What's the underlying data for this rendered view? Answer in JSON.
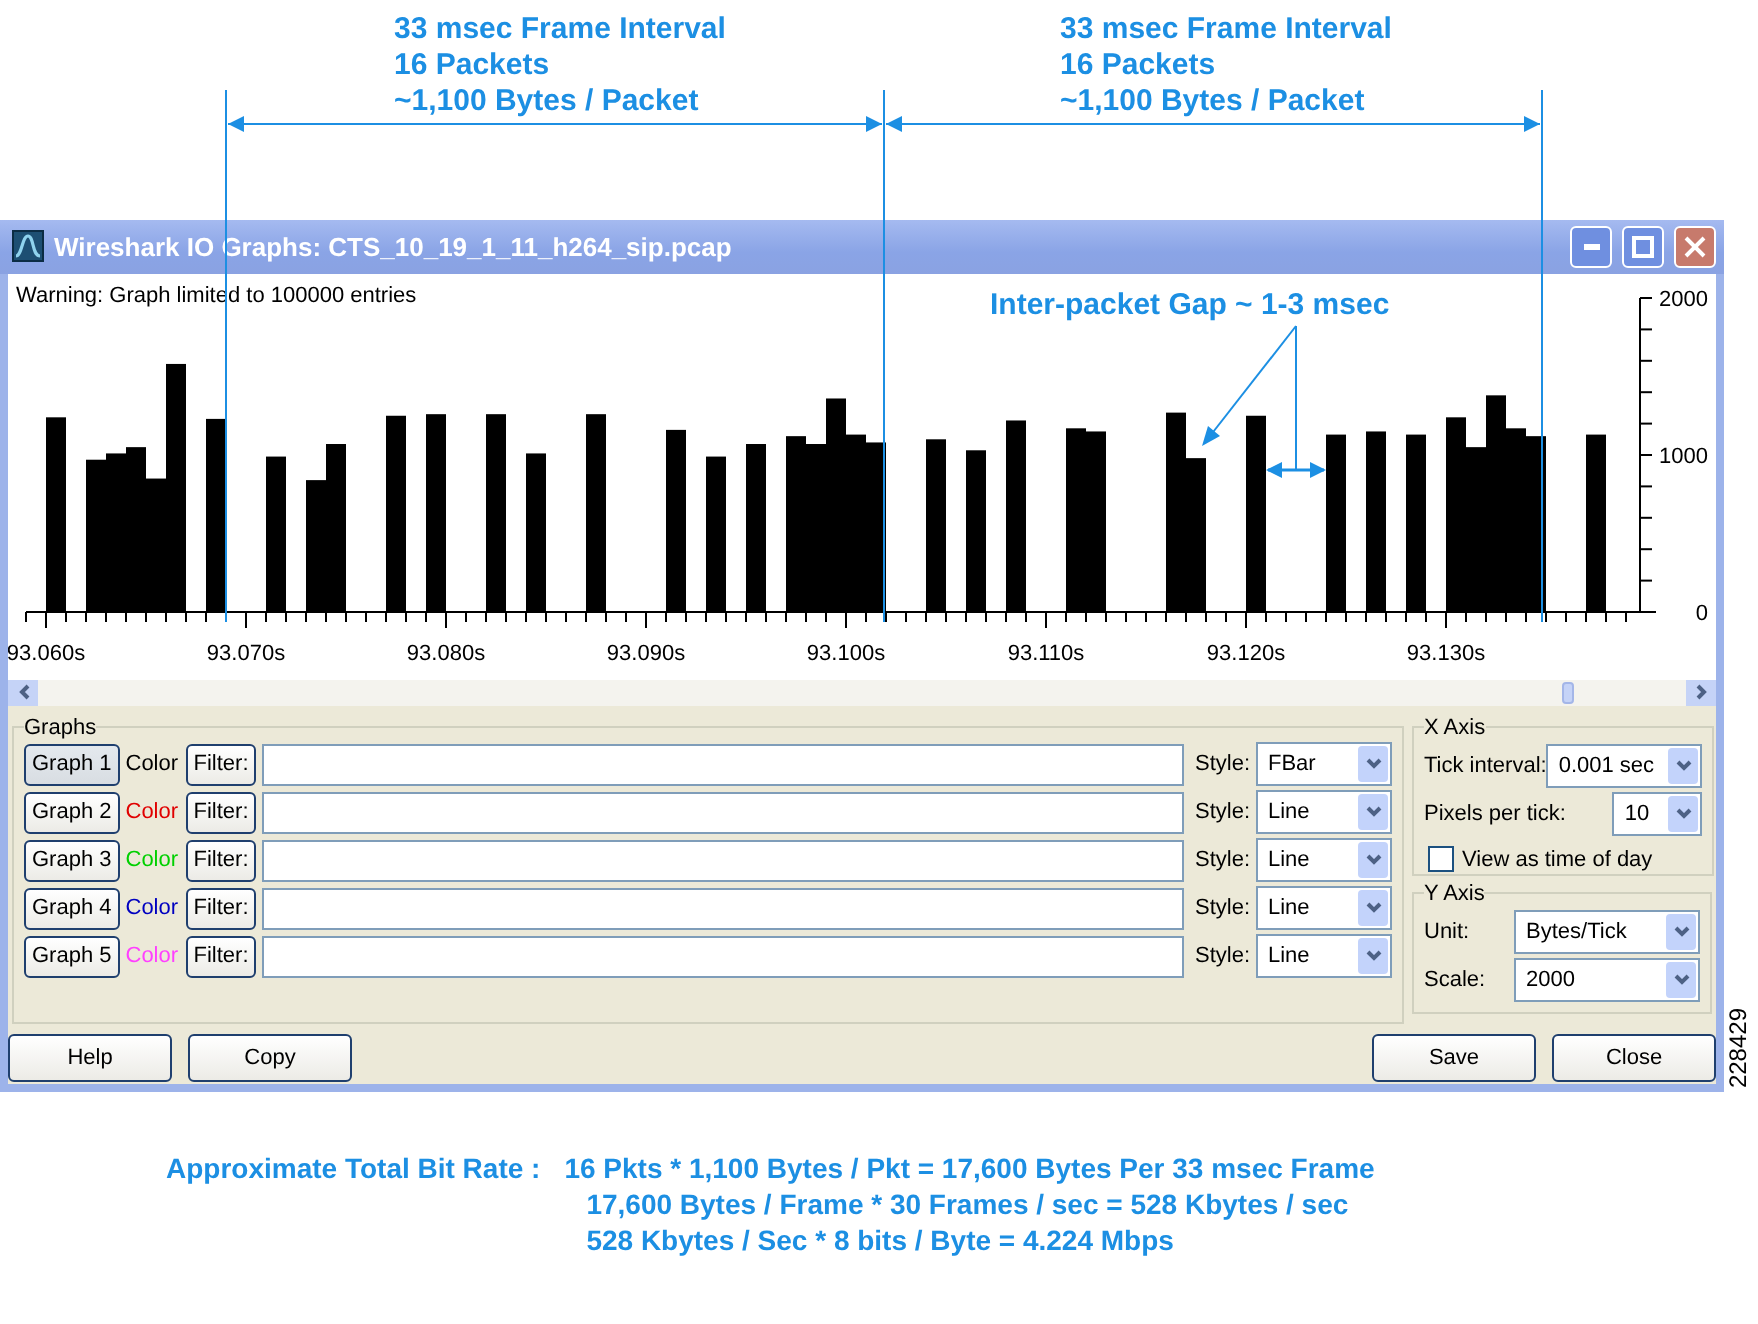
{
  "annotations": {
    "frame_intervals": [
      {
        "lines": [
          "33 msec Frame Interval",
          "16 Packets",
          "~1,100 Bytes / Packet"
        ]
      },
      {
        "lines": [
          "33 msec Frame Interval",
          "16 Packets",
          "~1,100 Bytes / Packet"
        ]
      }
    ],
    "gap_label": "Inter-packet Gap ~ 1-3 msec"
  },
  "window": {
    "title": "Wireshark IO Graphs: CTS_10_19_1_11_h264_sip.pcap",
    "warning": "Warning: Graph limited to 100000 entries",
    "chart_data": {
      "type": "bar",
      "x": [
        93.0605,
        93.0625,
        93.0635,
        93.0645,
        93.0655,
        93.0665,
        93.0685,
        93.0715,
        93.0735,
        93.0745,
        93.0775,
        93.0795,
        93.0825,
        93.0845,
        93.0875,
        93.0915,
        93.0935,
        93.0955,
        93.0975,
        93.0985,
        93.0995,
        93.1005,
        93.1015,
        93.1045,
        93.1065,
        93.1085,
        93.1115,
        93.1125,
        93.1165,
        93.1175,
        93.1205,
        93.1245,
        93.1265,
        93.1285,
        93.1305,
        93.1315,
        93.1325,
        93.1335,
        93.1345,
        93.1375
      ],
      "series": [
        {
          "color": "#000000",
          "values": [
            1240,
            970,
            1010,
            1050,
            850,
            1580,
            1230,
            990,
            840,
            1070,
            1250,
            1260,
            1260,
            1010,
            1260,
            1160,
            990,
            1070,
            1120,
            1070,
            1360,
            1130,
            1080,
            1100,
            1030,
            1220,
            1170,
            1150,
            1270,
            980,
            1250,
            1130,
            1150,
            1130,
            1240,
            1050,
            1380,
            1170,
            1120,
            1130
          ]
        }
      ],
      "xlim": [
        93.059,
        93.1397
      ],
      "ylim": [
        0,
        2000
      ],
      "xticks": [
        {
          "value": 93.06,
          "label": "93.060s"
        },
        {
          "value": 93.07,
          "label": "93.070s"
        },
        {
          "value": 93.08,
          "label": "93.080s"
        },
        {
          "value": 93.09,
          "label": "93.090s"
        },
        {
          "value": 93.1,
          "label": "93.100s"
        },
        {
          "value": 93.11,
          "label": "93.110s"
        },
        {
          "value": 93.12,
          "label": "93.120s"
        },
        {
          "value": 93.13,
          "label": "93.130s"
        }
      ],
      "yticks": [
        0,
        1000,
        2000
      ]
    },
    "graphs": {
      "title": "Graphs",
      "rows": [
        {
          "button": "Graph 1",
          "color_label": "Color",
          "color": "#000000",
          "filter_button": "Filter:",
          "style_label": "Style:",
          "style": "FBar",
          "selected": true
        },
        {
          "button": "Graph 2",
          "color_label": "Color",
          "color": "#e00000",
          "filter_button": "Filter:",
          "style_label": "Style:",
          "style": "Line",
          "selected": false
        },
        {
          "button": "Graph 3",
          "color_label": "Color",
          "color": "#00d000",
          "filter_button": "Filter:",
          "style_label": "Style:",
          "style": "Line",
          "selected": false
        },
        {
          "button": "Graph 4",
          "color_label": "Color",
          "color": "#0000c0",
          "filter_button": "Filter:",
          "style_label": "Style:",
          "style": "Line",
          "selected": false
        },
        {
          "button": "Graph 5",
          "color_label": "Color",
          "color": "#ff40ff",
          "filter_button": "Filter:",
          "style_label": "Style:",
          "style": "Line",
          "selected": false
        }
      ]
    },
    "x_axis": {
      "title": "X Axis",
      "tick_interval_label": "Tick interval:",
      "tick_interval": "0.001 sec",
      "pixels_label": "Pixels per tick:",
      "pixels": "10",
      "view_time_label": "View as time of day",
      "view_time_checked": false
    },
    "y_axis": {
      "title": "Y Axis",
      "unit_label": "Unit:",
      "unit": "Bytes/Tick",
      "scale_label": "Scale:",
      "scale": "2000"
    },
    "left_buttons": [
      "Help",
      "Copy"
    ],
    "right_buttons": [
      "Save",
      "Close"
    ]
  },
  "bit_rate": {
    "label": "Approximate Total Bit Rate :",
    "lines": [
      "16 Pkts * 1,100 Bytes / Pkt = 17,600 Bytes Per 33 msec Frame",
      "17,600 Bytes / Frame * 30 Frames / sec = 528 Kbytes / sec",
      "528 Kbytes / Sec * 8 bits / Byte = 4.224 Mbps"
    ]
  },
  "figure_number": "228429"
}
